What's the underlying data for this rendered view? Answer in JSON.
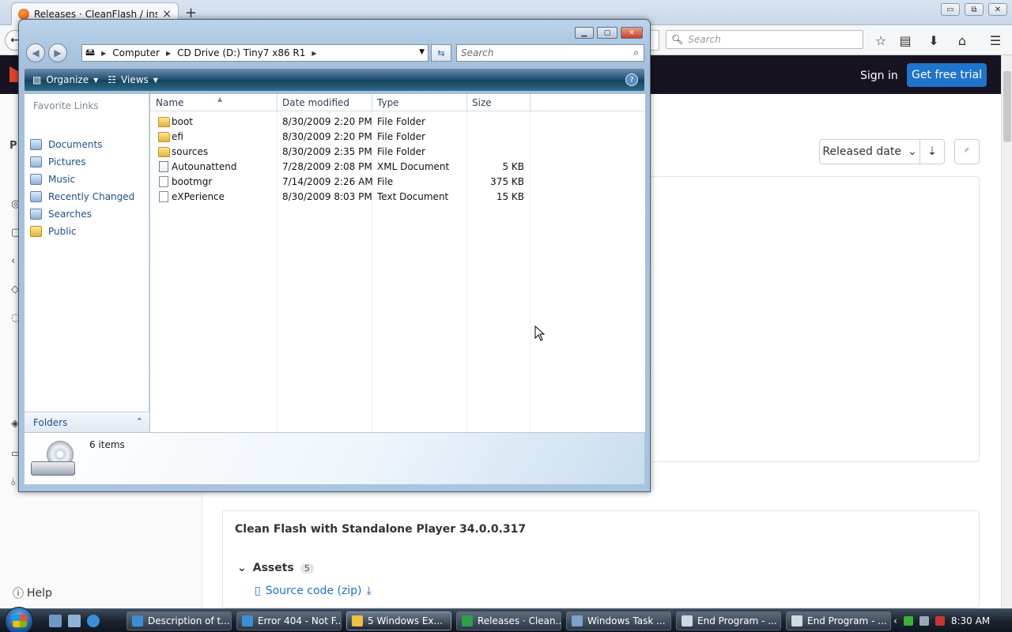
{
  "browser": {
    "tab_title": "Releases · CleanFlash / insta",
    "tab_close": "×",
    "new_tab": "+",
    "search_placeholder": "Search",
    "back_icon": "arrow-left-icon",
    "min": "▭",
    "max": "⧉",
    "close": "✕"
  },
  "gitlab": {
    "signin": "Sign in",
    "free_trial": "Get free trial",
    "sort_label": "Released date",
    "sort_chevron": "⌄",
    "sort_dir_icon": "sort-descending-icon",
    "rss_icon": "rss-icon",
    "help": "Help",
    "release_title": "Clean Flash with Standalone Player 34.0.0.317",
    "assets_label": "Assets",
    "assets_count": "5",
    "source_link": "Source code (zip)",
    "sidebar_initial": "P"
  },
  "explorer": {
    "address": [
      "Computer",
      "CD Drive (D:) Tiny7 x86 R1"
    ],
    "search_placeholder": "Search",
    "organize": "Organize",
    "views": "Views",
    "help": "?",
    "favorite_links_title": "Favorite Links",
    "favorite_links": [
      "Documents",
      "Pictures",
      "Music",
      "Recently Changed",
      "Searches",
      "Public"
    ],
    "folders_label": "Folders",
    "columns": {
      "name": "Name",
      "date": "Date modified",
      "type": "Type",
      "size": "Size"
    },
    "files": [
      {
        "name": "boot",
        "date": "8/30/2009 2:20 PM",
        "type": "File Folder",
        "size": "",
        "icon": "folder"
      },
      {
        "name": "efi",
        "date": "8/30/2009 2:20 PM",
        "type": "File Folder",
        "size": "",
        "icon": "folder"
      },
      {
        "name": "sources",
        "date": "8/30/2009 2:35 PM",
        "type": "File Folder",
        "size": "",
        "icon": "folder"
      },
      {
        "name": "Autounattend",
        "date": "7/28/2009 2:08 PM",
        "type": "XML Document",
        "size": "5 KB",
        "icon": "xml"
      },
      {
        "name": "bootmgr",
        "date": "7/14/2009 2:26 AM",
        "type": "File",
        "size": "375 KB",
        "icon": "doc"
      },
      {
        "name": "eXPerience",
        "date": "8/30/2009 8:03 PM",
        "type": "Text Document",
        "size": "15 KB",
        "icon": "doc"
      }
    ],
    "item_count": "6 items"
  },
  "taskbar": {
    "buttons": [
      {
        "label": "Description of t...",
        "color": "#3a8fd8"
      },
      {
        "label": "Error 404 - Not F...",
        "color": "#3a8fd8"
      },
      {
        "label": "5 Windows Ex...",
        "color": "#f0c040"
      },
      {
        "label": "Releases · Clean...",
        "color": "#2aa04a"
      },
      {
        "label": "Windows Task ...",
        "color": "#7fa0c8"
      },
      {
        "label": "End Program - ...",
        "color": "#d0d8e0"
      },
      {
        "label": "End Program - ...",
        "color": "#d0d8e0"
      }
    ],
    "clock": "8:30 AM",
    "tray_chevron": "‹"
  }
}
